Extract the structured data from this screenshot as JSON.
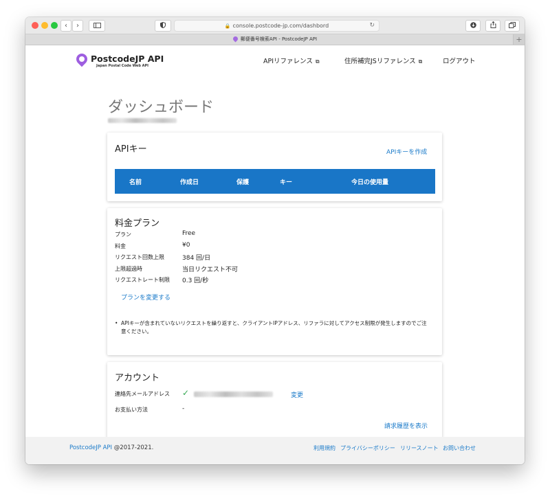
{
  "browser": {
    "url": "console.postcode-jp.com/dashbord",
    "tab_title": "郵便番号検索API - PostcodeJP API",
    "back_icon": "chevron-left-icon",
    "forward_icon": "chevron-right-icon",
    "sidebar_icon": "sidebar-icon",
    "shield_icon": "shield-icon",
    "download_icon": "download-icon",
    "share_icon": "share-icon",
    "tabs_icon": "tabs-icon",
    "new_tab": "+"
  },
  "header": {
    "logo_name": "PostcodeJP API",
    "logo_sub": "Japan Postal Code Web API",
    "nav": [
      {
        "label": "APIリファレンス"
      },
      {
        "label": "住所補完JSリファレンス"
      },
      {
        "label": "ログアウト"
      }
    ]
  },
  "main": {
    "title": "ダッシュボード",
    "api_keys": {
      "title": "APIキー",
      "create_label": "APIキーを作成",
      "columns": [
        "名前",
        "作成日",
        "保護",
        "キー",
        "今日の使用量"
      ]
    },
    "plan": {
      "title": "料金プラン",
      "rows": [
        {
          "label": "プラン",
          "value": "Free"
        },
        {
          "label": "料金",
          "value": "¥0"
        },
        {
          "label": "リクエスト回数上限",
          "value": "384 回/日"
        },
        {
          "label": "上限超過時",
          "value": "当日リクエスト不可"
        },
        {
          "label": "リクエストレート制限",
          "value": "0.3 回/秒"
        }
      ],
      "change_label": "プランを変更する",
      "note": "APIキーが含まれていないリクエストを繰り返すと、クライアントIPアドレス、リファラに対してアクセス制限が発生しますのでご注意ください。"
    },
    "account": {
      "title": "アカウント",
      "email_label": "連絡先メールアドレス",
      "change_label": "変更",
      "payment_label": "お支払い方法",
      "payment_value": "-",
      "billing_label": "請求履歴を表示"
    }
  },
  "footer": {
    "brand": "PostcodeJP API",
    "copyright": " @2017-2021.",
    "links": [
      "利用規約",
      "プライバシーポリシー",
      "リリースノート",
      "お問い合わせ"
    ]
  },
  "colors": {
    "accent": "#1976c7",
    "link": "#1a7ac9",
    "check": "#35a853",
    "logo": "#9e5ee0"
  }
}
